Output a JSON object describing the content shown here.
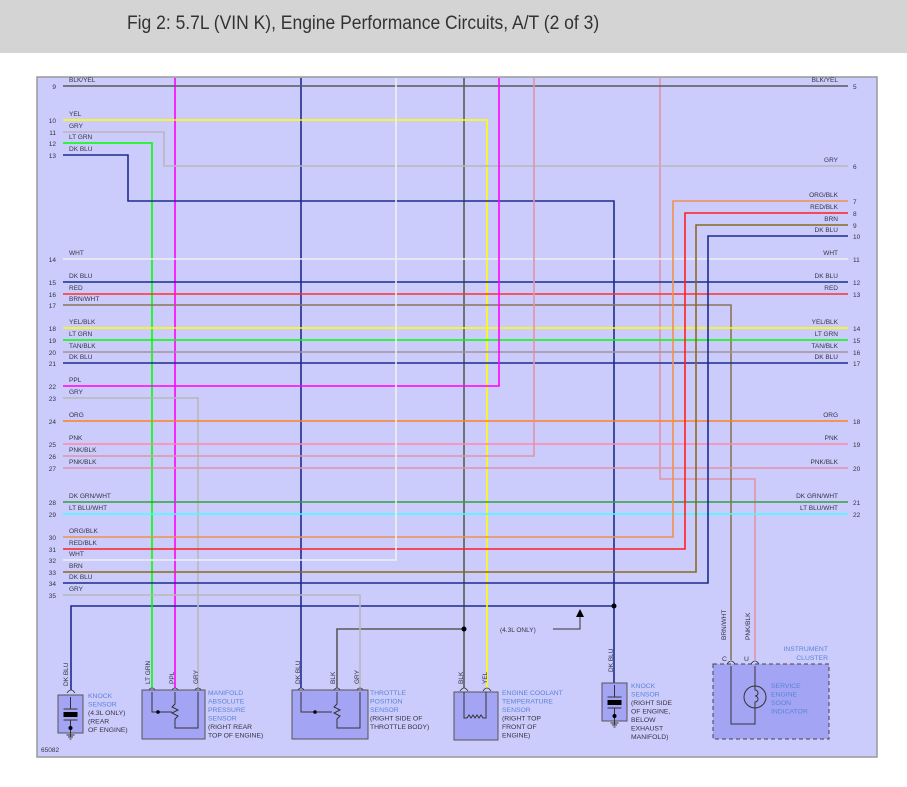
{
  "title": "Fig 2: 5.7L (VIN K), Engine Performance Circuits, A/T (2 of 3)",
  "figure_number": "65082",
  "colors": {
    "background": "#ccccfc",
    "component_fill": "#a4a4f4",
    "component_label": "#5a84d8",
    "text": "#333344"
  },
  "left_wires": [
    {
      "pin": "9",
      "label": "BLK/YEL",
      "color": "#5a5a5a"
    },
    {
      "pin": "10",
      "label": "YEL",
      "color": "#ffff00"
    },
    {
      "pin": "11",
      "label": "GRY",
      "color": "#b8b8b8"
    },
    {
      "pin": "12",
      "label": "LT GRN",
      "color": "#00ff00"
    },
    {
      "pin": "13",
      "label": "DK BLU",
      "color": "#1c2c8c"
    },
    {
      "pin": "14",
      "label": "WHT",
      "color": "#eeeeee"
    },
    {
      "pin": "15",
      "label": "DK BLU",
      "color": "#1c2c8c"
    },
    {
      "pin": "16",
      "label": "RED",
      "color": "#ff3030"
    },
    {
      "pin": "17",
      "label": "BRN/WHT",
      "color": "#8a7458"
    },
    {
      "pin": "18",
      "label": "YEL/BLK",
      "color": "#ffff00"
    },
    {
      "pin": "19",
      "label": "LT GRN",
      "color": "#00ff00"
    },
    {
      "pin": "20",
      "label": "TAN/BLK",
      "color": "#a09498"
    },
    {
      "pin": "21",
      "label": "DK BLU",
      "color": "#1c2c8c"
    },
    {
      "pin": "22",
      "label": "PPL",
      "color": "#ff00ff"
    },
    {
      "pin": "23",
      "label": "GRY",
      "color": "#b8b8b8"
    },
    {
      "pin": "24",
      "label": "ORG",
      "color": "#ff8020"
    },
    {
      "pin": "25",
      "label": "PNK",
      "color": "#ff88a8"
    },
    {
      "pin": "26",
      "label": "PNK/BLK",
      "color": "#e094a8"
    },
    {
      "pin": "27",
      "label": "PNK/BLK",
      "color": "#e094a8"
    },
    {
      "pin": "28",
      "label": "DK GRN/WHT",
      "color": "#30a040"
    },
    {
      "pin": "29",
      "label": "LT BLU/WHT",
      "color": "#40ffff"
    },
    {
      "pin": "30",
      "label": "ORG/BLK",
      "color": "#f09050"
    },
    {
      "pin": "31",
      "label": "RED/BLK",
      "color": "#ff2020"
    },
    {
      "pin": "32",
      "label": "WHT",
      "color": "#eeeeee"
    },
    {
      "pin": "33",
      "label": "BRN",
      "color": "#8a6a20"
    },
    {
      "pin": "34",
      "label": "DK BLU",
      "color": "#1c2c8c"
    },
    {
      "pin": "35",
      "label": "GRY",
      "color": "#b8b8b8"
    }
  ],
  "right_wires": [
    {
      "pin": "5",
      "label": "BLK/YEL"
    },
    {
      "pin": "6",
      "label": "GRY"
    },
    {
      "pin": "7",
      "label": "ORG/BLK"
    },
    {
      "pin": "8",
      "label": "RED/BLK"
    },
    {
      "pin": "9",
      "label": "BRN"
    },
    {
      "pin": "10",
      "label": "DK BLU"
    },
    {
      "pin": "11",
      "label": "WHT"
    },
    {
      "pin": "12",
      "label": "DK BLU"
    },
    {
      "pin": "13",
      "label": "RED"
    },
    {
      "pin": "14",
      "label": "YEL/BLK"
    },
    {
      "pin": "15",
      "label": "LT GRN"
    },
    {
      "pin": "16",
      "label": "TAN/BLK"
    },
    {
      "pin": "17",
      "label": "DK BLU"
    },
    {
      "pin": "18",
      "label": "ORG"
    },
    {
      "pin": "19",
      "label": "PNK"
    },
    {
      "pin": "20",
      "label": "PNK/BLK"
    },
    {
      "pin": "21",
      "label": "DK GRN/WHT"
    },
    {
      "pin": "22",
      "label": "LT BLU/WHT"
    }
  ],
  "connector_labels": [
    "DK BLU",
    "LT GRN",
    "PPL",
    "GRY",
    "DK BLU",
    "BLK",
    "GRY",
    "BLK",
    "YEL",
    "DK BLU",
    "BRN/WHT",
    "PNK/BLK"
  ],
  "note": "(4.3L ONLY)",
  "components": [
    {
      "name": [
        "KNOCK",
        "SENSOR"
      ],
      "location": [
        "(4.3L ONLY)",
        "(REAR",
        "OF ENGINE)"
      ]
    },
    {
      "name": [
        "MANIFOLD",
        "ABSOLUTE",
        "PRESSURE",
        "SENSOR"
      ],
      "location": [
        "(RIGHT REAR",
        "TOP OF ENGINE)"
      ]
    },
    {
      "name": [
        "THROTTLE",
        "POSITION",
        "SENSOR"
      ],
      "location": [
        "(RIGHT SIDE OF",
        "THROTTLE BODY)"
      ]
    },
    {
      "name": [
        "ENGINE COOLANT",
        "TEMPERATURE",
        "SENSOR"
      ],
      "location": [
        "(RIGHT TOP",
        "FRONT OF",
        "ENGINE)"
      ]
    },
    {
      "name": [
        "KNOCK",
        "SENSOR"
      ],
      "location": [
        "(RIGHT SIDE",
        "OF ENGINE,",
        "BELOW",
        "EXHAUST",
        "MANIFOLD)"
      ]
    }
  ],
  "instrument_cluster": {
    "title": [
      "INSTRUMENT",
      "CLUSTER"
    ],
    "pins": [
      "C",
      "U"
    ],
    "indicator": [
      "SERVICE",
      "ENGINE",
      "SOON",
      "INDICATOR"
    ]
  }
}
